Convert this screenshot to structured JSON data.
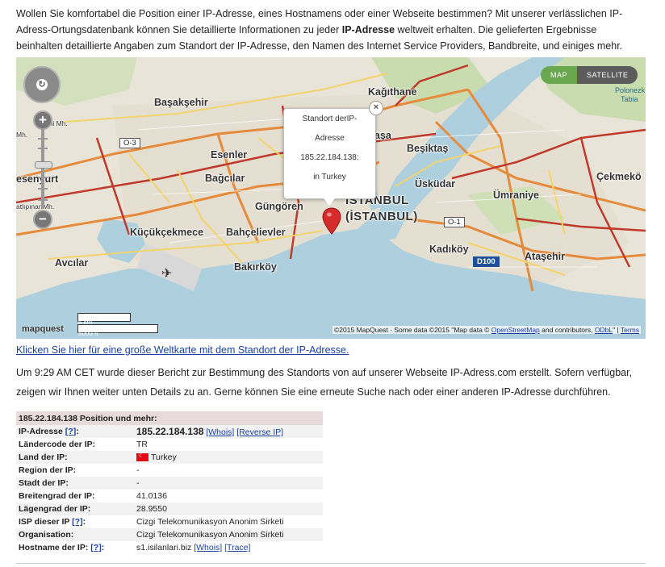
{
  "intro": {
    "text_1": "Wollen Sie komfortabel die Position einer IP-Adresse, eines Hostnamens oder einer Webseite bestimmen? Mit unserer verlässlichen IP-Adress-Ortungsdatenbank können Sie detaillierte Informationen zu jeder ",
    "bold": "IP-Adresse",
    "text_2": " weltweit erhalten. Die gelieferten Ergebnisse beinhalten detaillierte Angaben zum Standort der IP-Adresse, den Namen des Internet Service Providers, Bandbreite, und einiges mehr."
  },
  "map": {
    "toggle": {
      "map": "MAP",
      "satellite": "SATELLITE"
    },
    "zoom": {
      "plus": "+",
      "minus": "−"
    },
    "nav_center": "↻",
    "places": {
      "basaksehir": "Başakşehir",
      "kagithane": "Kağıthane",
      "besiktas": "Beşiktaş",
      "esenler": "Esenler",
      "bagcilar": "Bağcılar",
      "uskudar": "Üsküdar",
      "cekmekoy": "Çekmekö",
      "umraniye": "Ümraniye",
      "gungoren": "Güngören",
      "istanbul": "İSTANBUL",
      "istanbul_paren": "(İSTANBUL)",
      "kucukcekmece": "Küçükçekmece",
      "bahcelievler": "Bahçelievler",
      "kadikoy": "Kadıköy",
      "atasehir": "Ataşehir",
      "avcilar": "Avcılar",
      "bakirkoy": "Bakırköy",
      "esenyurt": "esenyurt",
      "pasa": "aşa",
      "polonezkoy": "Polonezk",
      "polonezkoy2": "Tabia",
      "ikitelli": "İkitelli Mh.",
      "tatlipinar": "atlıpınar Mh.",
      "mh2": "Mh."
    },
    "shields": {
      "o3": "O-3",
      "o1": "O-1",
      "d100": "D100"
    },
    "popup": {
      "line1": "Standort derIP-",
      "line2": "Adresse",
      "line3": "185.22.184.138:",
      "line4": "in Turkey"
    },
    "close": "×",
    "scale": {
      "km": "5 km",
      "mi": "5000 ft"
    },
    "logo": "mapquest",
    "attribution": {
      "pre": "©2015 MapQuest  ·  Some data ©2015 \"Map data © ",
      "osm": "OpenStreetMap",
      "mid": " and contributors, ",
      "odbl": "ODbL",
      "sep": "\" | ",
      "terms": "Terms"
    }
  },
  "big_map_link": "Klicken Sie hier für eine große Weltkarte mit dem Standort der IP-Adresse.",
  "report": "Um 9:29 AM CET wurde dieser Bericht zur Bestimmung des Standorts von auf unserer Webseite IP-Adress.com erstellt. Sofern verfügbar, zeigen wir Ihnen weiter unten Details zu an. Gerne können Sie eine erneute Suche nach oder einer anderen IP-Adresse durchführen.",
  "table": {
    "header": "185.22.184.138 Position und mehr:",
    "help": "[?]",
    "rows": {
      "ip_label": "IP-Adresse",
      "ip_value": "185.22.184.138",
      "whois": "[Whois]",
      "reverse": "[Reverse IP]",
      "cc_label": "Ländercode der IP:",
      "cc_value": "TR",
      "country_label": "Land der IP:",
      "country_value": "Turkey",
      "region_label": "Region der IP:",
      "region_value": "-",
      "city_label": "Stadt der IP:",
      "city_value": "-",
      "lat_label": "Breitengrad der IP:",
      "lat_value": "41.0136",
      "lon_label": "Lägengrad der IP:",
      "lon_value": "28.9550",
      "isp_label": "ISP dieser IP",
      "isp_value": "Cizgi Telekomunikasyon Anonim Sirketi",
      "org_label": "Organisation:",
      "org_value": "Cizgi Telekomunikasyon Anonim Sirketi",
      "host_label": "Hostname der IP:",
      "host_value": "s1.isilanlari.biz",
      "trace": "[Trace]"
    }
  }
}
